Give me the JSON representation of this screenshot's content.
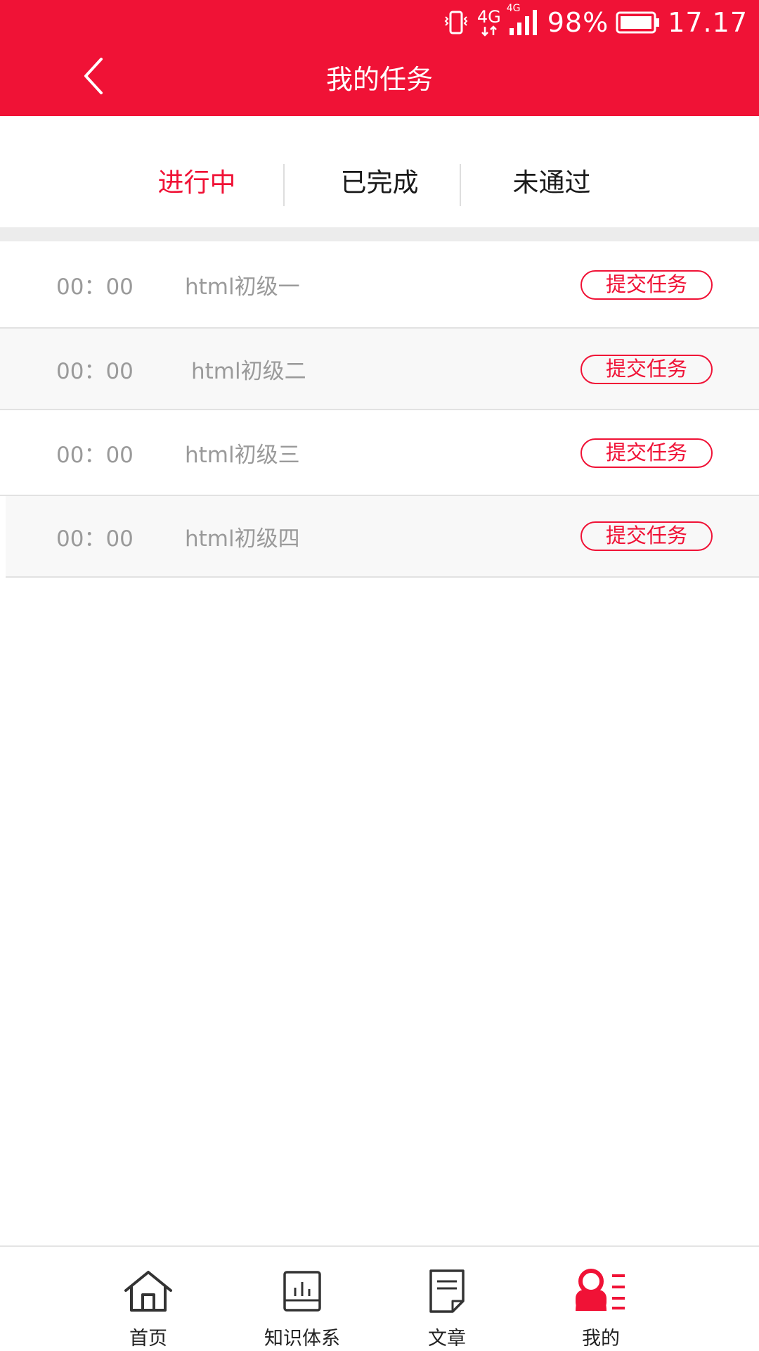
{
  "status_bar": {
    "network_label": "4G",
    "network_label_small": "4G",
    "battery_percent": "98%",
    "clock": "17.17"
  },
  "header": {
    "title": "我的任务",
    "back_icon": "chevron-left-icon"
  },
  "tabs": [
    {
      "label": "进行中",
      "active": true
    },
    {
      "label": "已完成",
      "active": false
    },
    {
      "label": "未通过",
      "active": false
    }
  ],
  "tasks": [
    {
      "time": "00：00",
      "name": "html初级一",
      "action": "提交任务"
    },
    {
      "time": "00：00",
      "name": "html初级二",
      "action": "提交任务"
    },
    {
      "time": "00：00",
      "name": "html初级三",
      "action": "提交任务"
    },
    {
      "time": "00：00",
      "name": "html初级四",
      "action": "提交任务"
    }
  ],
  "bottom_nav": [
    {
      "label": "首页",
      "icon": "home-icon",
      "active": false
    },
    {
      "label": "知识体系",
      "icon": "knowledge-icon",
      "active": false
    },
    {
      "label": "文章",
      "icon": "document-icon",
      "active": false
    },
    {
      "label": "我的",
      "icon": "profile-icon",
      "active": true
    }
  ],
  "colors": {
    "brand": "#f01236",
    "text_muted": "#9a9a9a",
    "text_dark": "#1a1a1a",
    "separator": "#ececec"
  }
}
